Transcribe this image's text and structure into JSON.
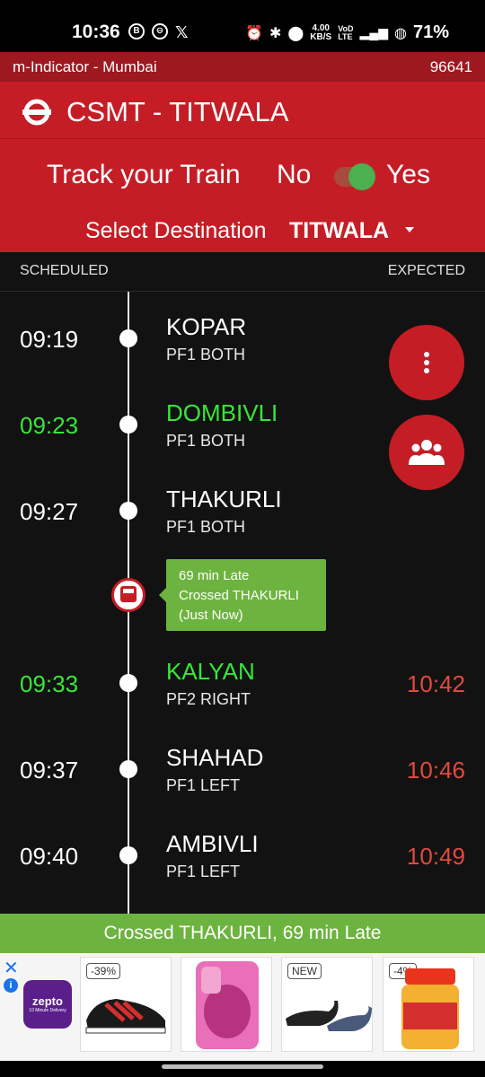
{
  "status_bar": {
    "time": "10:36",
    "speed": "4.00",
    "speed_unit": "KB/S",
    "battery": "71%"
  },
  "app_bar": {
    "title": "m-Indicator - Mumbai",
    "count": "96641"
  },
  "header": {
    "route": "CSMT - TITWALA",
    "track_label": "Track your Train",
    "track_no": "No",
    "track_yes": "Yes",
    "track_enabled": true,
    "dest_label": "Select Destination",
    "dest_value": "TITWALA"
  },
  "columns": {
    "scheduled": "SCHEDULED",
    "expected": "EXPECTED"
  },
  "stations": [
    {
      "scheduled": "09:19",
      "name": "KOPAR",
      "platform": "PF1 BOTH",
      "expected": "",
      "highlight": false
    },
    {
      "scheduled": "09:23",
      "name": "DOMBIVLI",
      "platform": "PF1 BOTH",
      "expected": "",
      "highlight": true
    },
    {
      "scheduled": "09:27",
      "name": "THAKURLI",
      "platform": "PF1 BOTH",
      "expected": "",
      "highlight": false
    },
    {
      "scheduled": "09:33",
      "name": "KALYAN",
      "platform": "PF2 RIGHT",
      "expected": "10:42",
      "highlight": true
    },
    {
      "scheduled": "09:37",
      "name": "SHAHAD",
      "platform": "PF1 LEFT",
      "expected": "10:46",
      "highlight": false
    },
    {
      "scheduled": "09:40",
      "name": "AMBIVLI",
      "platform": "PF1 LEFT",
      "expected": "10:49",
      "highlight": false
    }
  ],
  "train_status": {
    "line1": "69 min Late",
    "line2": "Crossed THAKURLI",
    "line3": "(Just Now)"
  },
  "banner": "Crossed THAKURLI, 69 min Late",
  "ads": {
    "brand": "zepto",
    "brand_sub": "10 Minute Delivery",
    "badges": [
      "-39%",
      "",
      "NEW",
      "-4%"
    ]
  },
  "colors": {
    "primary_red": "#c51d26",
    "dark_red": "#9e1820",
    "highlight_green": "#39e639",
    "status_green": "#6db33f",
    "expected_red": "#e04a3c"
  }
}
